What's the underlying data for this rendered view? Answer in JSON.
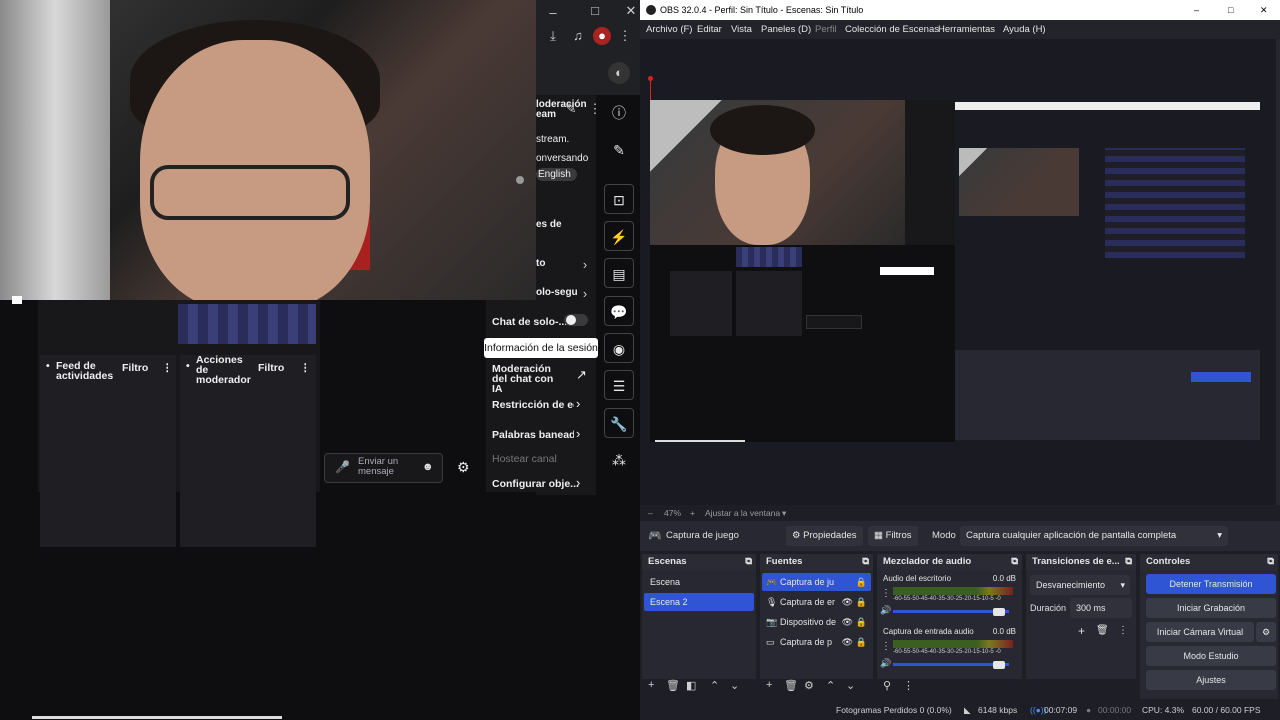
{
  "left": {
    "browser_top_icons": [
      "download-icon",
      "media-icon",
      "extension-icon",
      "more-icon"
    ],
    "chat_panel_fragments": [
      "loderación",
      "eam",
      "stream.",
      "onversando",
      "English",
      "es de",
      "to",
      "olo-segu"
    ],
    "feed_col": {
      "title": "Feed de actividades",
      "filter": "Filtro"
    },
    "mod_col": {
      "title": "Acciones de moderador",
      "filter": "Filtro"
    },
    "menu_items": [
      {
        "label": "Chat de solo-...",
        "toggle": true
      },
      {
        "label": "Moderación del chat con IA"
      },
      {
        "label": "Restricción de edad"
      },
      {
        "label": "Palabras baneadas"
      },
      {
        "label": "Hostear canal",
        "disabled": true
      },
      {
        "label": "Configurar obje..."
      }
    ],
    "tooltip": "Información de la sesión",
    "message_placeholder": "Enviar un mensaje"
  },
  "obs": {
    "title": "OBS 32.0.4 - Perfil: Sin Título - Escenas: Sin Título",
    "menu": [
      "Archivo (F)",
      "Editar",
      "Vista",
      "Paneles (D)",
      "Perfil",
      "Colección de Escenas",
      "Herramientas",
      "Ayuda (H)"
    ],
    "zoom": "47%",
    "fit": "Ajustar a la ventana",
    "source_name": "Captura de juego",
    "props_btn": "Propiedades",
    "filters_btn": "Filtros",
    "mode_label": "Modo",
    "mode_value": "Captura cualquier aplicación de pantalla completa",
    "docks": {
      "scenes": {
        "title": "Escenas",
        "items": [
          "Escena",
          "Escena 2"
        ],
        "selected": 1
      },
      "sources": {
        "title": "Fuentes",
        "items": [
          "Captura de ju",
          "Captura de er",
          "Dispositivo de",
          "Captura de p"
        ]
      },
      "mixer": {
        "title": "Mezclador de audio",
        "channels": [
          {
            "name": "Audio del escritorio",
            "db": "0.0 dB"
          },
          {
            "name": "Captura de entrada audio",
            "db": "0.0 dB"
          }
        ],
        "scale": "-60-55-50-45-40-35-30-25-20-15-10-5 -0"
      },
      "transitions": {
        "title": "Transiciones de e...",
        "value": "Desvanecimiento",
        "duration_label": "Duración",
        "duration": "300 ms"
      },
      "controls": {
        "title": "Controles",
        "buttons": [
          "Detener Transmisión",
          "Iniciar Grabación",
          "Iniciar Cámara Virtual",
          "Modo Estudio",
          "Ajustes"
        ]
      }
    },
    "status": {
      "dropped": "Fotogramas Perdidos 0 (0.0%)",
      "bitrate": "6148 kbps",
      "live_time": "00:07:09",
      "rec_time": "00:00:00",
      "cpu": "CPU: 4.3%",
      "fps": "60.00 / 60.00 FPS"
    }
  }
}
